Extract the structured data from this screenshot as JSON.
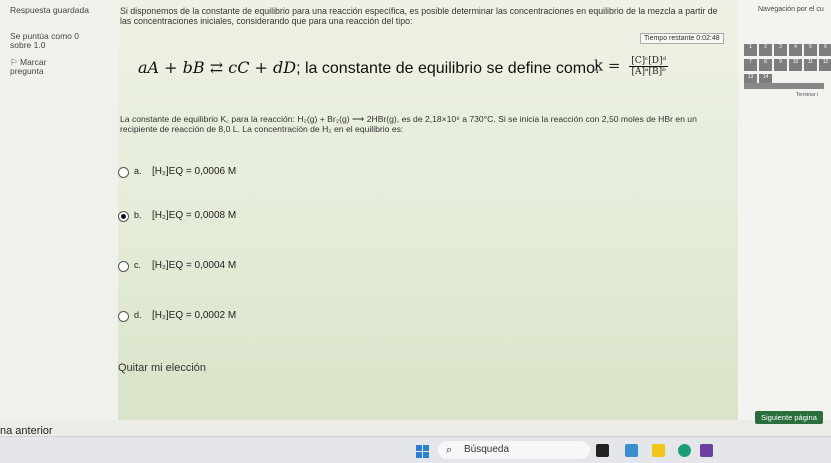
{
  "question_info": {
    "status": "Respuesta guardada",
    "score": "Se puntúa como 0 sobre 1.0",
    "flag_label": "Marcar pregunta"
  },
  "question": {
    "intro": "Si disponemos de la constante de equilibrio para una reacción específica, es posible determinar las concentraciones en equilibrio de la mezcla a partir de las concentraciones iniciales, considerando que para una reacción del tipo:",
    "timer": "Tiempo restante 0:02:48",
    "reaction_general": "aA + bB ⇄ cC + dD",
    "definition_text": "; la constante de equilibrio se define como:",
    "k_symbol": "k =",
    "k_numerator": "[C]ᶜ[D]ᵈ",
    "k_denominator": "[A]ᵃ[B]ᵇ",
    "statement": "La constante de equilibrio K꜀ para la reacción: H₂(g) + Br₂(g) ⟶ 2HBr(g), es de 2,18×10⁶ a 730°C. Si se inicia la reacción con 2,50 moles de HBr en un recipiente de reacción de 8,0 L. La concentración de H₂ en el equilibrio es:",
    "options": [
      {
        "letter": "a.",
        "text": "[H₂]EQ = 0,0006 M",
        "selected": false
      },
      {
        "letter": "b.",
        "text": "[H₂]EQ = 0,0008 M",
        "selected": true
      },
      {
        "letter": "c.",
        "text": "[H₂]EQ = 0,0004 M",
        "selected": false
      },
      {
        "letter": "d.",
        "text": "[H₂]EQ = 0,0002 M",
        "selected": false
      }
    ],
    "clear_choice": "Quitar mi elección"
  },
  "navigation": {
    "title": "Navegación por el cu",
    "cells": [
      "1",
      "2",
      "3",
      "4",
      "5",
      "6",
      "7",
      "8",
      "9",
      "10",
      "11",
      "12",
      "13",
      "14"
    ],
    "finish": "Terminar i",
    "next_button": "Siguiente página",
    "previous": "na anterior"
  },
  "taskbar": {
    "search_placeholder": "Búsqueda",
    "search_icon": "magnifier-icon",
    "colors": {
      "windows": "#2f7fd1",
      "next_button": "#2a6e3c"
    }
  }
}
